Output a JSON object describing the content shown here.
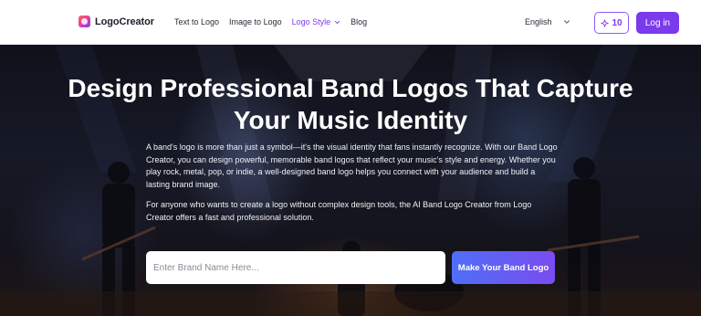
{
  "header": {
    "brand": "LogoCreator",
    "nav": [
      {
        "label": "Text to Logo"
      },
      {
        "label": "Image to Logo"
      },
      {
        "label": "Logo Style"
      },
      {
        "label": "Blog"
      }
    ],
    "language": "English",
    "credits": "10",
    "login_label": "Log in"
  },
  "hero": {
    "title": "Design Professional Band Logos That Capture Your Music Identity",
    "paragraph_1": "A band's logo is more than just a symbol—it's the visual identity that fans instantly recognize. With our Band Logo Creator, you can design powerful, memorable band logos that reflect your music's style and energy. Whether you play rock, metal, pop, or indie, a well-designed band logo helps you connect with your audience and build a lasting brand image.",
    "paragraph_2": "For anyone who wants to create a logo without complex design tools, the AI Band Logo Creator from Logo Creator offers a fast and professional solution.",
    "input_placeholder": "Enter Brand Name Here...",
    "input_value": "",
    "cta_label": "Make Your Band Logo"
  },
  "colors": {
    "accent": "#7c3aed",
    "cta_gradient_start": "#4f6ef7",
    "cta_gradient_end": "#7a4cf0"
  }
}
